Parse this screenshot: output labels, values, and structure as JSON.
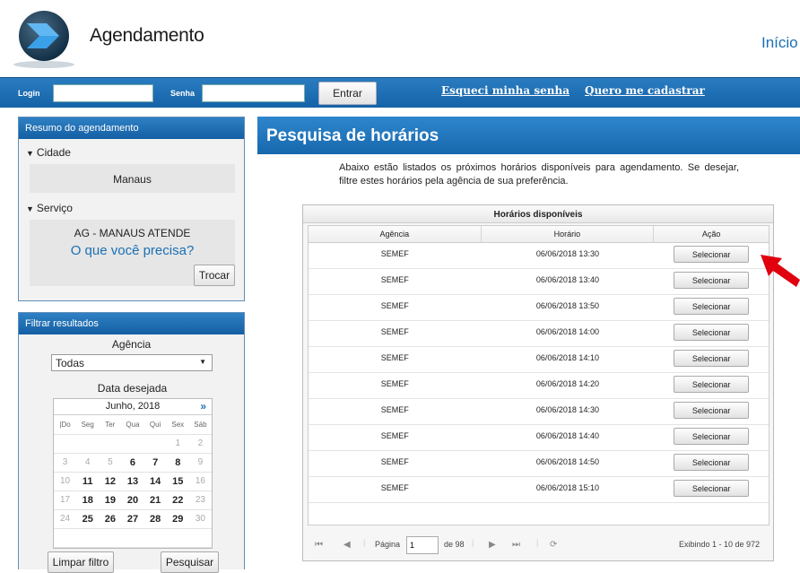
{
  "header": {
    "title": "Agendamento",
    "nav_inicio": "Início"
  },
  "login": {
    "login_label": "Login",
    "senha_label": "Senha",
    "login_value": "",
    "senha_value": "",
    "enter_button": "Entrar",
    "forgot_link": "Esqueci minha senha",
    "register_link": "Quero me cadastrar"
  },
  "summary": {
    "title": "Resumo do agendamento",
    "city_label": "Cidade",
    "city_value": "Manaus",
    "service_label": "Serviço",
    "service_value": "AG - MANAUS ATENDE",
    "service_question": "O que você precisa?",
    "change_button": "Trocar"
  },
  "filter": {
    "title": "Filtrar resultados",
    "agency_label": "Agência",
    "agency_selected": "Todas",
    "date_label": "Data desejada",
    "clear_button": "Limpar filtro",
    "search_button": "Pesquisar",
    "calendar": {
      "month": "Junho, 2018",
      "next": "»",
      "day_names": [
        "|Do",
        "Seg",
        "Ter",
        "Qua",
        "Qui",
        "Sex",
        "Sáb"
      ],
      "weeks": [
        [
          {
            "d": ""
          },
          {
            "d": ""
          },
          {
            "d": ""
          },
          {
            "d": ""
          },
          {
            "d": ""
          },
          {
            "d": "1"
          },
          {
            "d": "2"
          }
        ],
        [
          {
            "d": "3"
          },
          {
            "d": "4"
          },
          {
            "d": "5"
          },
          {
            "d": "6",
            "a": true
          },
          {
            "d": "7",
            "a": true
          },
          {
            "d": "8",
            "a": true
          },
          {
            "d": "9"
          }
        ],
        [
          {
            "d": "10"
          },
          {
            "d": "11",
            "a": true
          },
          {
            "d": "12",
            "a": true
          },
          {
            "d": "13",
            "a": true
          },
          {
            "d": "14",
            "a": true
          },
          {
            "d": "15",
            "a": true
          },
          {
            "d": "16"
          }
        ],
        [
          {
            "d": "17"
          },
          {
            "d": "18",
            "a": true
          },
          {
            "d": "19",
            "a": true
          },
          {
            "d": "20",
            "a": true
          },
          {
            "d": "21",
            "a": true
          },
          {
            "d": "22",
            "a": true
          },
          {
            "d": "23"
          }
        ],
        [
          {
            "d": "24"
          },
          {
            "d": "25",
            "a": true
          },
          {
            "d": "26",
            "a": true
          },
          {
            "d": "27",
            "a": true
          },
          {
            "d": "28",
            "a": true
          },
          {
            "d": "29",
            "a": true
          },
          {
            "d": "30"
          }
        ],
        [
          {
            "d": ""
          },
          {
            "d": ""
          },
          {
            "d": ""
          },
          {
            "d": ""
          },
          {
            "d": ""
          },
          {
            "d": ""
          },
          {
            "d": ""
          }
        ]
      ]
    }
  },
  "main": {
    "title": "Pesquisa de horários",
    "intro": "Abaixo estão listados os próximos horários disponíveis para agendamento. Se desejar, filtre estes horários pela agência de sua preferência."
  },
  "grid": {
    "title": "Horários disponíveis",
    "columns": [
      "Agência",
      "Horário",
      "Ação"
    ],
    "select_label": "Selecionar",
    "rows": [
      {
        "agency": "SEMEF",
        "time": "06/06/2018 13:30"
      },
      {
        "agency": "SEMEF",
        "time": "06/06/2018 13:40"
      },
      {
        "agency": "SEMEF",
        "time": "06/06/2018 13:50"
      },
      {
        "agency": "SEMEF",
        "time": "06/06/2018 14:00"
      },
      {
        "agency": "SEMEF",
        "time": "06/06/2018 14:10"
      },
      {
        "agency": "SEMEF",
        "time": "06/06/2018 14:20"
      },
      {
        "agency": "SEMEF",
        "time": "06/06/2018 14:30"
      },
      {
        "agency": "SEMEF",
        "time": "06/06/2018 14:40"
      },
      {
        "agency": "SEMEF",
        "time": "06/06/2018 14:50"
      },
      {
        "agency": "SEMEF",
        "time": "06/06/2018 15:10"
      }
    ],
    "pager": {
      "page_label": "Página",
      "page_value": "1",
      "of_label": "de 98",
      "summary": "Exibindo 1 - 10 de 972"
    }
  },
  "colors": {
    "brand_blue": "#1768ad",
    "link_blue": "#1a6fb5",
    "annotation_red": "#e0000e"
  }
}
